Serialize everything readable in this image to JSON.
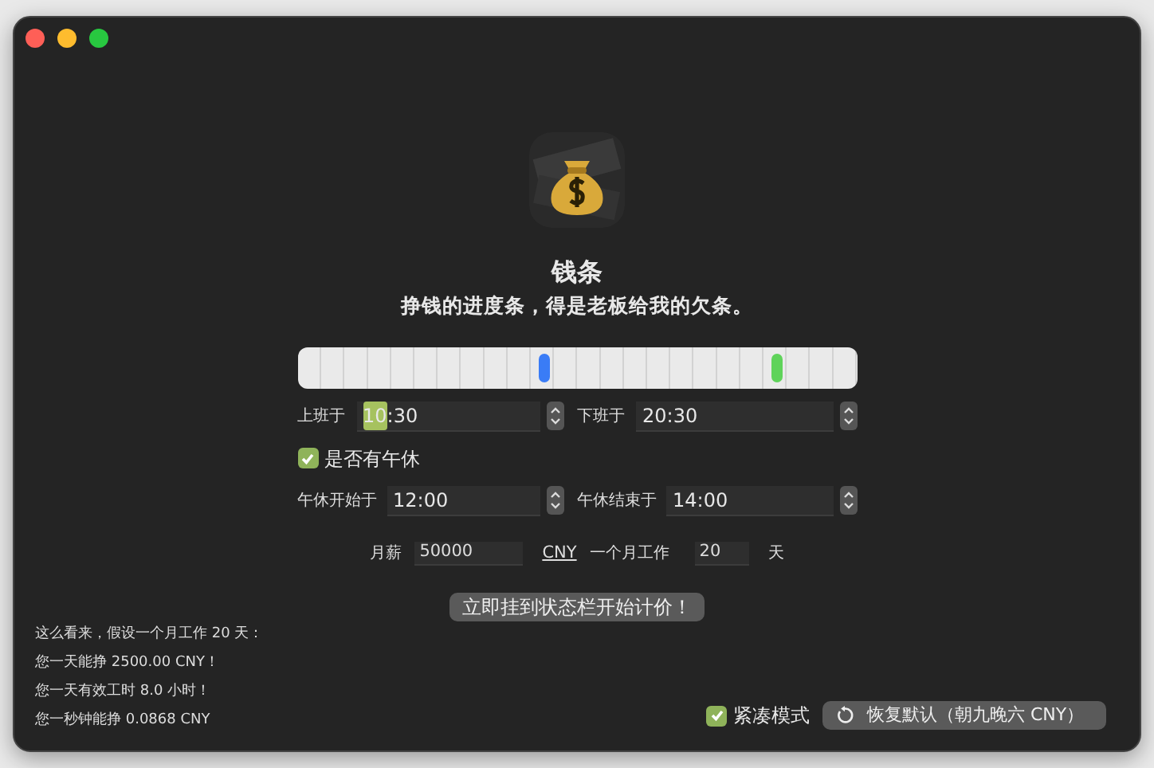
{
  "window": {
    "traffic_lights": [
      {
        "color": "#fe5f57"
      },
      {
        "color": "#febc2e"
      },
      {
        "color": "#28c840"
      }
    ]
  },
  "app": {
    "title": "钱条",
    "subtitle": "挣钱的进度条，得是老板给我的欠条。"
  },
  "timeline": {
    "markers": [
      {
        "color": "#3a7cf6",
        "level": 0.44
      },
      {
        "color": "#5fd35a",
        "level": 0.855
      }
    ]
  },
  "work_row": [
    {
      "label": "上班于",
      "value_parts": [
        {
          "text": "10",
          "selected": true
        },
        {
          "text": ":30",
          "selected": false
        }
      ]
    },
    {
      "label": "下班于",
      "value_parts": [
        {
          "text": "20:30",
          "selected": false
        }
      ]
    }
  ],
  "lunch_toggle": {
    "label": "是否有午休",
    "checked": true
  },
  "lunch_row": [
    {
      "label": "午休开始于",
      "value_parts": [
        {
          "text": "12:00",
          "selected": false
        }
      ]
    },
    {
      "label": "午休结束于",
      "value_parts": [
        {
          "text": "14:00",
          "selected": false
        }
      ]
    }
  ],
  "salary": {
    "label": "月薪",
    "value": "50000",
    "currency": "CNY",
    "days_label": "一个月工作",
    "days": "20",
    "days_unit": "天"
  },
  "start_button": "立即挂到状态栏开始计价！",
  "summary": [
    "这么看来，假设一个月工作 20 天：",
    "您一天能挣 2500.00 CNY！",
    "您一天有效工时 8.0 小时！",
    "您一秒钟能挣 0.0868 CNY"
  ],
  "compact_mode": {
    "label": "紧凑模式",
    "checked": true
  },
  "reset_button": "恢复默认（朝九晚六 CNY）"
}
